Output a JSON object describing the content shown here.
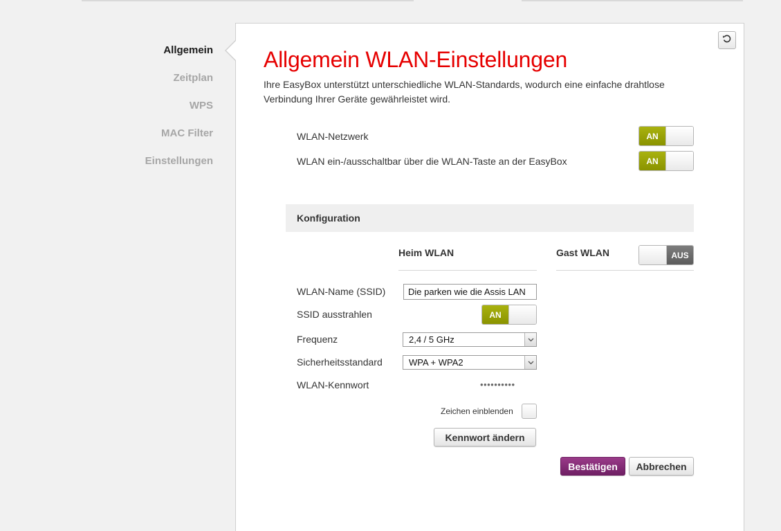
{
  "sidebar": {
    "items": [
      {
        "label": "Allgemein",
        "active": true
      },
      {
        "label": "Zeitplan",
        "active": false
      },
      {
        "label": "WPS",
        "active": false
      },
      {
        "label": "MAC Filter",
        "active": false
      },
      {
        "label": "Einstellungen",
        "active": false
      }
    ]
  },
  "page": {
    "title": "Allgemein WLAN-Einstellungen",
    "description": "Ihre EasyBox unterstützt unterschiedliche WLAN-Standards, wodurch eine einfache drahtlose Verbindung Ihrer Geräte gewährleistet wird."
  },
  "general": {
    "wlan_network_label": "WLAN-Netzwerk",
    "wlan_network_state": "AN",
    "wlan_button_label": "WLAN ein-/ausschaltbar über die WLAN-Taste an der EasyBox",
    "wlan_button_state": "AN"
  },
  "config": {
    "header": "Konfiguration",
    "home_col": "Heim WLAN",
    "guest_col": "Gast WLAN",
    "guest_state": "AUS",
    "ssid_label": "WLAN-Name (SSID)",
    "ssid_value": "Die parken wie die Assis LAN",
    "broadcast_label": "SSID ausstrahlen",
    "broadcast_state": "AN",
    "frequency_label": "Frequenz",
    "frequency_value": "2,4 / 5 GHz",
    "security_label": "Sicherheitsstandard",
    "security_value": "WPA + WPA2",
    "password_label": "WLAN-Kennwort",
    "password_masked": "••••••••••",
    "show_chars_label": "Zeichen einblenden",
    "change_password_label": "Kennwort ändern"
  },
  "actions": {
    "confirm_label": "Bestätigen",
    "cancel_label": "Abbrechen"
  },
  "colors": {
    "title_red": "#e60000",
    "toggle_green": "#9aa300",
    "primary_purple": "#7e2a72"
  }
}
